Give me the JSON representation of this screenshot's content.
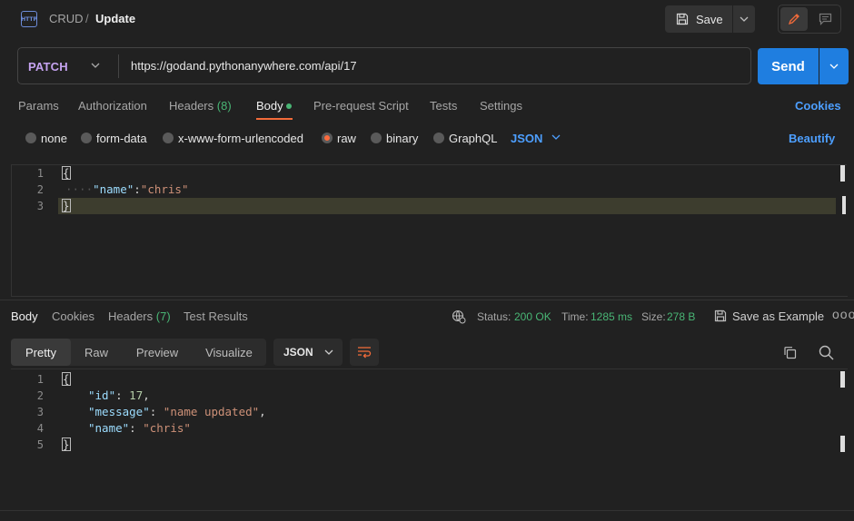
{
  "breadcrumb": {
    "parent": "CRUD",
    "separator": "/",
    "current": "Update"
  },
  "toolbar": {
    "save_label": "Save"
  },
  "request": {
    "method": "PATCH",
    "url": "https://godand.pythonanywhere.com/api/17",
    "send_label": "Send"
  },
  "request_tabs": {
    "params": "Params",
    "authorization": "Authorization",
    "headers": "Headers",
    "headers_count": "(8)",
    "body": "Body",
    "prerequest": "Pre-request Script",
    "tests": "Tests",
    "settings": "Settings",
    "cookies": "Cookies"
  },
  "body_types": {
    "none": "none",
    "form_data": "form-data",
    "urlencoded": "x-www-form-urlencoded",
    "raw": "raw",
    "binary": "binary",
    "graphql": "GraphQL",
    "format": "JSON",
    "beautify": "Beautify",
    "selected": "raw"
  },
  "request_body": {
    "line_numbers": [
      "1",
      "2",
      "3"
    ],
    "open_brace": "{",
    "indent_dots": "····",
    "key": "\"name\"",
    "colon": ":",
    "value": "\"chris\"",
    "close_brace": "}"
  },
  "response_tabs": {
    "body": "Body",
    "cookies": "Cookies",
    "headers": "Headers",
    "headers_count": "(7)",
    "test_results": "Test Results"
  },
  "response_status": {
    "status_label": "Status:",
    "status_value": "200 OK",
    "time_label": "Time:",
    "time_value": "1285 ms",
    "size_label": "Size:",
    "size_value": "278 B",
    "save_example": "Save as Example",
    "more": "ooo"
  },
  "response_view": {
    "pretty": "Pretty",
    "raw": "Raw",
    "preview": "Preview",
    "visualize": "Visualize",
    "format": "JSON"
  },
  "response_body": {
    "line_numbers": [
      "1",
      "2",
      "3",
      "4",
      "5"
    ],
    "open_brace": "{",
    "id_key": "\"id\"",
    "id_value": "17",
    "message_key": "\"message\"",
    "message_value": "\"name updated\"",
    "name_key": "\"name\"",
    "name_value": "\"chris\"",
    "close_brace": "}"
  },
  "colors": {
    "accent": "#1f7ee0",
    "success": "#49b675",
    "method": "#c5a3f0",
    "link": "#4d9fff",
    "active_tab": "#f26b3a"
  }
}
